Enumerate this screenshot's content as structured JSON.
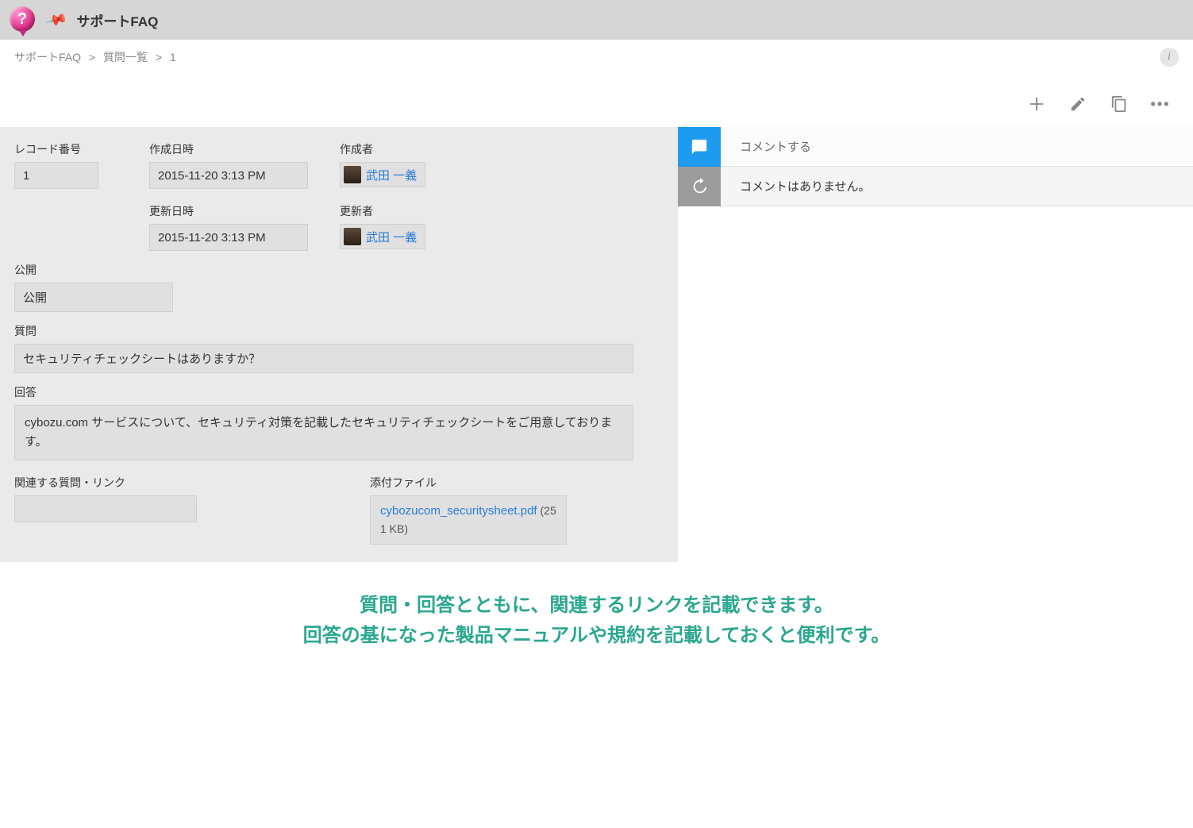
{
  "app": {
    "title": "サポートFAQ"
  },
  "breadcrumb": {
    "root": "サポートFAQ",
    "list": "質問一覧",
    "id": "1"
  },
  "fields": {
    "record_no": {
      "label": "レコード番号",
      "value": "1"
    },
    "created_at": {
      "label": "作成日時",
      "value": "2015-11-20 3:13 PM"
    },
    "created_by": {
      "label": "作成者",
      "value": "武田 一義"
    },
    "updated_at": {
      "label": "更新日時",
      "value": "2015-11-20 3:13 PM"
    },
    "updated_by": {
      "label": "更新者",
      "value": "武田 一義"
    },
    "publish": {
      "label": "公開",
      "value": "公開"
    },
    "question": {
      "label": "質問",
      "value": "セキュリティチェックシートはありますか？"
    },
    "answer": {
      "label": "回答",
      "value": "cybozu.com サービスについて、セキュリティ対策を記載したセキュリティチェックシートをご用意しております。"
    },
    "related": {
      "label": "関連する質問・リンク"
    },
    "attachment": {
      "label": "添付ファイル",
      "filename": "cybozucom_securitysheet.pdf",
      "size": "(251 KB)"
    }
  },
  "comments": {
    "placeholder": "コメントする",
    "empty": "コメントはありません。"
  },
  "footer": {
    "line1": "質問・回答とともに、関連するリンクを記載できます。",
    "line2": "回答の基になった製品マニュアルや規約を記載しておくと便利です。"
  }
}
